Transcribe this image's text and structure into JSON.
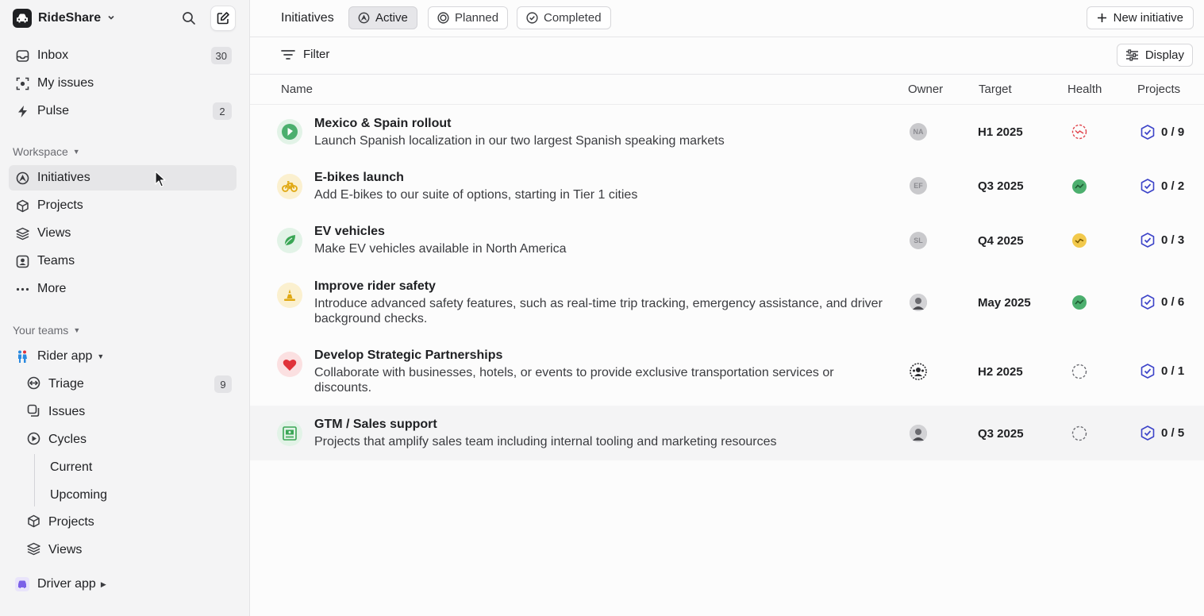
{
  "workspace": {
    "name": "RideShare"
  },
  "sidebar": {
    "inbox": {
      "label": "Inbox",
      "count": "30"
    },
    "my_issues": {
      "label": "My issues"
    },
    "pulse": {
      "label": "Pulse",
      "count": "2"
    },
    "workspace_section": "Workspace",
    "initiatives": "Initiatives",
    "projects": "Projects",
    "views": "Views",
    "teams": "Teams",
    "more": "More",
    "your_teams_section": "Your teams",
    "rider_app": {
      "label": "Rider app",
      "triage": {
        "label": "Triage",
        "count": "9"
      },
      "issues": "Issues",
      "cycles": "Cycles",
      "current": "Current",
      "upcoming": "Upcoming",
      "projects": "Projects",
      "views": "Views"
    },
    "driver_app": {
      "label": "Driver app"
    }
  },
  "header": {
    "title": "Initiatives",
    "tabs": [
      "Active",
      "Planned",
      "Completed"
    ],
    "new_button": "New initiative"
  },
  "toolbar": {
    "filter": "Filter",
    "display": "Display"
  },
  "columns": {
    "name": "Name",
    "owner": "Owner",
    "target": "Target",
    "health": "Health",
    "projects": "Projects"
  },
  "rows": [
    {
      "name": "Mexico & Spain rollout",
      "desc": "Launch Spanish localization in our two largest Spanish speaking markets",
      "owner": "NA",
      "target": "H1 2025",
      "health": "off-track",
      "projects": "0 / 9",
      "icon": "flag-icon",
      "icon_color": "#4caf6e"
    },
    {
      "name": "E-bikes launch",
      "desc": "Add E-bikes to our suite of options, starting in Tier 1 cities",
      "owner": "EF",
      "target": "Q3 2025",
      "health": "on-track",
      "projects": "0 / 2",
      "icon": "bike-icon",
      "icon_color": "#e8b21f"
    },
    {
      "name": "EV vehicles",
      "desc": "Make EV vehicles available in North America",
      "owner": "SL",
      "target": "Q4 2025",
      "health": "at-risk",
      "projects": "0 / 3",
      "icon": "leaf-icon",
      "icon_color": "#3aa655"
    },
    {
      "name": "Improve rider safety",
      "desc": "Introduce advanced safety features, such as real-time trip tracking, emergency assistance, and driver background checks.",
      "owner": "",
      "target": "May 2025",
      "health": "on-track",
      "projects": "0 / 6",
      "icon": "cone-icon",
      "icon_color": "#e8b21f"
    },
    {
      "name": "Develop Strategic Partnerships",
      "desc": "Collaborate with businesses, hotels, or events to provide exclusive transportation services or discounts.",
      "owner": "",
      "target": "H2 2025",
      "health": "none",
      "projects": "0 / 1",
      "icon": "heart-icon",
      "icon_color": "#e0333a"
    },
    {
      "name": "GTM / Sales support",
      "desc": "Projects that amplify sales team including internal tooling and marketing resources",
      "owner": "",
      "target": "Q3 2025",
      "health": "none",
      "projects": "0 / 5",
      "icon": "money-icon",
      "icon_color": "#3aa655"
    }
  ]
}
